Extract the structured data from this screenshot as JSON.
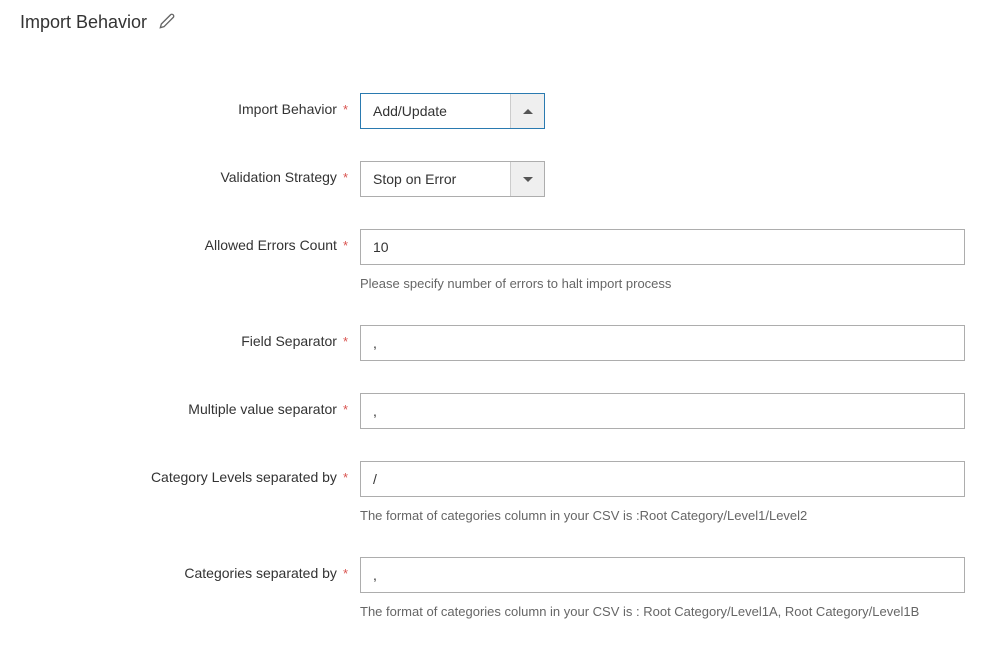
{
  "section": {
    "title": "Import Behavior"
  },
  "fields": {
    "import_behavior": {
      "label": "Import Behavior",
      "value": "Add/Update"
    },
    "validation_strategy": {
      "label": "Validation Strategy",
      "value": "Stop on Error"
    },
    "allowed_errors": {
      "label": "Allowed Errors Count",
      "value": "10",
      "help": "Please specify number of errors to halt import process"
    },
    "field_separator": {
      "label": "Field Separator",
      "value": ","
    },
    "multiple_value_separator": {
      "label": "Multiple value separator",
      "value": ","
    },
    "category_levels_separator": {
      "label": "Category Levels separated by",
      "value": "/",
      "help": "The format of categories column in your CSV is :Root Category/Level1/Level2"
    },
    "categories_separator": {
      "label": "Categories separated by",
      "value": ",",
      "help": "The format of categories column in your CSV is : Root Category/Level1A, Root Category/Level1B"
    }
  },
  "required_mark": "*"
}
